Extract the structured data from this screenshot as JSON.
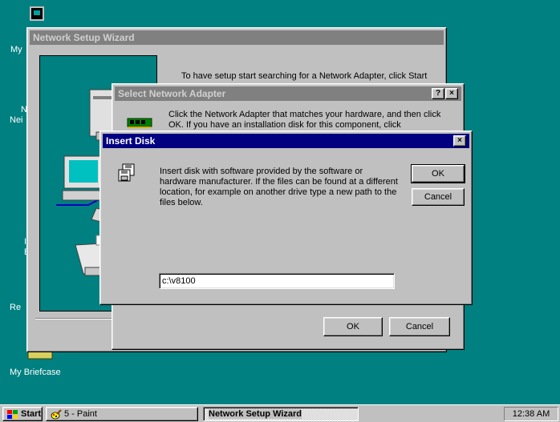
{
  "desktop": {
    "icons": [
      {
        "label": "My"
      },
      {
        "label": "N"
      },
      {
        "label": "Nei"
      },
      {
        "label": "I"
      },
      {
        "label": "E"
      },
      {
        "label": "Re"
      },
      {
        "label": "My Briefcase"
      }
    ]
  },
  "wizard": {
    "title": "Network Setup Wizard",
    "text": "To have setup start searching for a Network Adapter, click Start"
  },
  "select_adapter": {
    "title": "Select Network Adapter",
    "help_btn": "?",
    "close_btn": "×",
    "text": "Click the Network Adapter that matches your hardware, and then click OK.  If you have an installation disk for this component, click",
    "ok_label": "OK",
    "cancel_label": "Cancel"
  },
  "insert_disk": {
    "title": "Insert Disk",
    "close_btn": "×",
    "message": "Insert disk with software provided by the software or hardware manufacturer.  If the files can be found at a different location, for example on another drive type a new path to the files below.",
    "ok_label": "OK",
    "cancel_label": "Cancel",
    "path_value": "c:\\v8100"
  },
  "taskbar": {
    "start_label": "Start",
    "tasks": [
      {
        "label": "5 - Paint"
      },
      {
        "label": "Network Setup Wizard"
      }
    ],
    "clock": "12:38 AM"
  }
}
